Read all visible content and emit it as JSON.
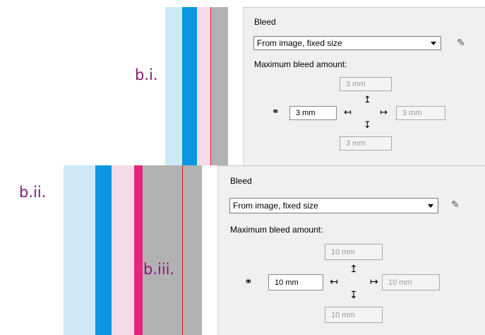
{
  "annotations": {
    "b_i": "b.i.",
    "b_ii": "b.ii.",
    "b_iii": "b.iii."
  },
  "colors": {
    "light_blue": "#cfe9f9",
    "cyan": "#0a96e0",
    "light_pink": "#f6dbe9",
    "magenta": "#e0287f",
    "grey": "#b2b2b2",
    "red_line": "#dd1e1e",
    "annotation_purple": "#8a1a78"
  },
  "panel_top": {
    "section_title": "Bleed",
    "dropdown_value": "From image, fixed size",
    "max_bleed_label": "Maximum bleed amount:",
    "top_value": "3 mm",
    "left_value": "3 mm",
    "right_value": "3 mm",
    "bottom_value": "3 mm"
  },
  "panel_bottom": {
    "section_title": "Bleed",
    "dropdown_value": "From image, fixed size",
    "max_bleed_label": "Maximum bleed amount:",
    "top_value": "10 mm",
    "left_value": "10 mm",
    "right_value": "10 mm",
    "bottom_value": "10 mm"
  },
  "icons": {
    "link": "chain-link-icon",
    "pencil": "pencil-icon",
    "up_arrow": "arrow-up-bar-icon",
    "down_arrow": "arrow-down-bar-icon",
    "left_arrow": "arrow-left-bar-icon",
    "right_arrow": "arrow-right-bar-icon"
  }
}
